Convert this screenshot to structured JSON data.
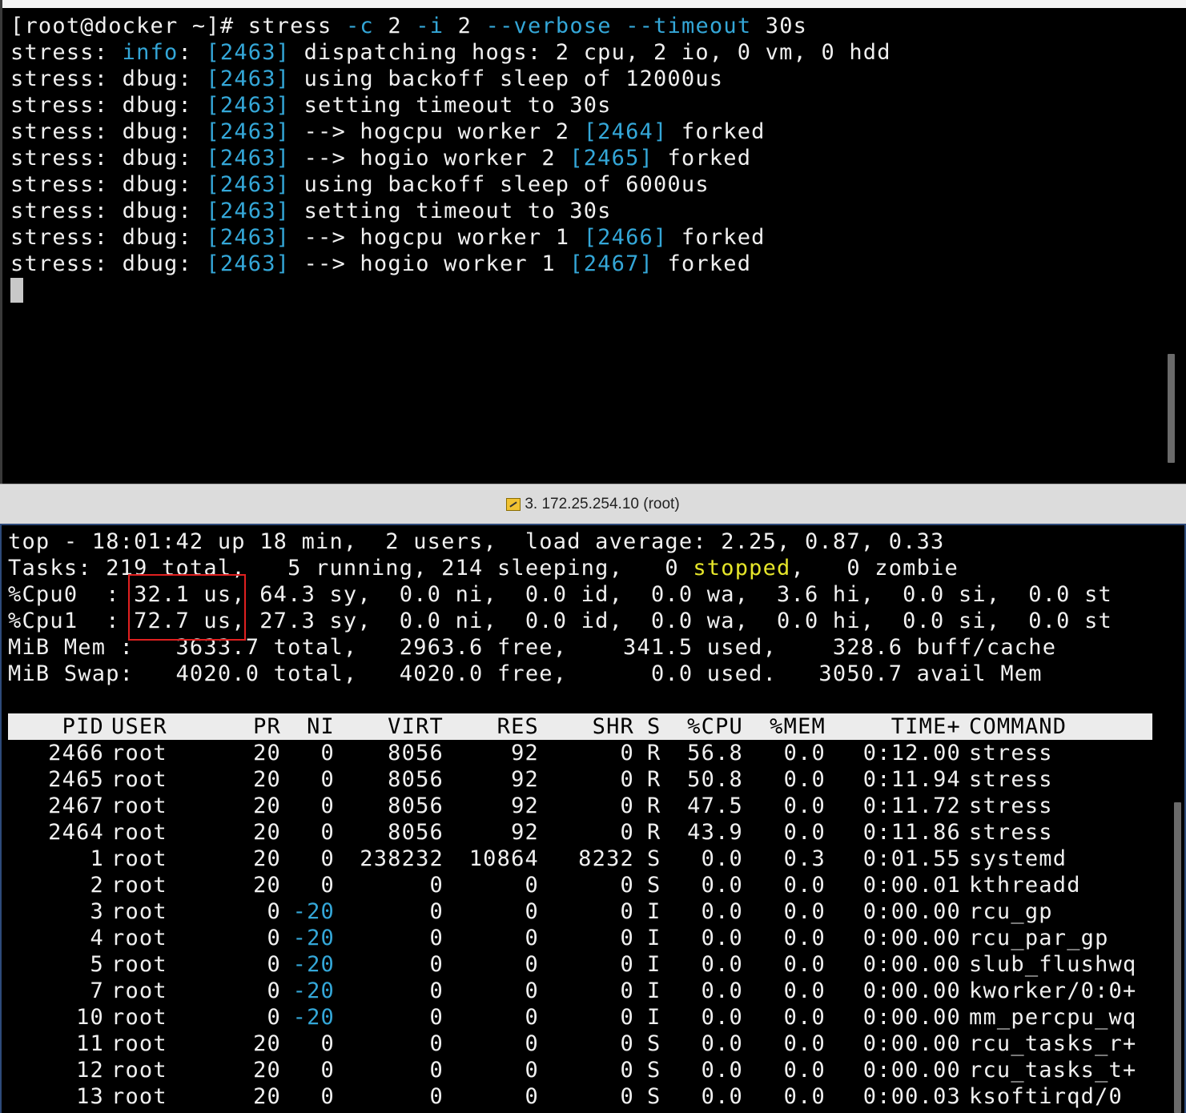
{
  "top_terminal": {
    "command_line": {
      "prompt": "[root@docker ~]# ",
      "cmd": "stress",
      "flag_c": "-c",
      "val_c": "2",
      "flag_i": "-i",
      "val_i": "2",
      "flag_verbose": "--verbose",
      "flag_timeout": "--timeout",
      "val_timeout": "30s"
    },
    "log_lines": [
      {
        "prefix": "stress: ",
        "level": "info",
        "pid": "[2463]",
        "msg": " dispatching hogs: 2 cpu, 2 io, 0 vm, 0 hdd",
        "worker_pid": "",
        "suffix": ""
      },
      {
        "prefix": "stress: ",
        "level": "dbug",
        "pid": "[2463]",
        "msg": " using backoff sleep of 12000us",
        "worker_pid": "",
        "suffix": ""
      },
      {
        "prefix": "stress: ",
        "level": "dbug",
        "pid": "[2463]",
        "msg": " setting timeout to 30s",
        "worker_pid": "",
        "suffix": ""
      },
      {
        "prefix": "stress: ",
        "level": "dbug",
        "pid": "[2463]",
        "msg": " --> hogcpu worker 2 ",
        "worker_pid": "[2464]",
        "suffix": " forked"
      },
      {
        "prefix": "stress: ",
        "level": "dbug",
        "pid": "[2463]",
        "msg": " --> hogio worker 2 ",
        "worker_pid": "[2465]",
        "suffix": " forked"
      },
      {
        "prefix": "stress: ",
        "level": "dbug",
        "pid": "[2463]",
        "msg": " using backoff sleep of 6000us",
        "worker_pid": "",
        "suffix": ""
      },
      {
        "prefix": "stress: ",
        "level": "dbug",
        "pid": "[2463]",
        "msg": " setting timeout to 30s",
        "worker_pid": "",
        "suffix": ""
      },
      {
        "prefix": "stress: ",
        "level": "dbug",
        "pid": "[2463]",
        "msg": " --> hogcpu worker 1 ",
        "worker_pid": "[2466]",
        "suffix": " forked"
      },
      {
        "prefix": "stress: ",
        "level": "dbug",
        "pid": "[2463]",
        "msg": " --> hogio worker 1 ",
        "worker_pid": "[2467]",
        "suffix": " forked"
      }
    ]
  },
  "tab_title": {
    "icon": "pencil-icon",
    "label": "3. 172.25.254.10 (root)"
  },
  "top_monitor": {
    "summary": {
      "line1": "top - 18:01:42 up 18 min,  2 users,  load average: 2.25, 0.87, 0.33",
      "tasks_a": "Tasks: 219 total,   5 running, 214 sleeping,   0 ",
      "tasks_stopped": "stopped",
      "tasks_b": ",   0 zombie",
      "cpu0": "%Cpu0  : 32.1 us, 64.3 sy,  0.0 ni,  0.0 id,  0.0 wa,  3.6 hi,  0.0 si,  0.0 st",
      "cpu1": "%Cpu1  : 72.7 us, 27.3 sy,  0.0 ni,  0.0 id,  0.0 wa,  0.0 hi,  0.0 si,  0.0 st",
      "mem": "MiB Mem :   3633.7 total,   2963.6 free,    341.5 used,    328.6 buff/cache",
      "swap": "MiB Swap:   4020.0 total,   4020.0 free,      0.0 used.   3050.7 avail Mem"
    },
    "columns": [
      "PID",
      "USER",
      "PR",
      "NI",
      "VIRT",
      "RES",
      "SHR",
      "S",
      "%CPU",
      "%MEM",
      "TIME+",
      "COMMAND"
    ],
    "processes": [
      [
        "2466",
        "root",
        "20",
        "0",
        "8056",
        "92",
        "0",
        "R",
        "56.8",
        "0.0",
        "0:12.00",
        "stress"
      ],
      [
        "2465",
        "root",
        "20",
        "0",
        "8056",
        "92",
        "0",
        "R",
        "50.8",
        "0.0",
        "0:11.94",
        "stress"
      ],
      [
        "2467",
        "root",
        "20",
        "0",
        "8056",
        "92",
        "0",
        "R",
        "47.5",
        "0.0",
        "0:11.72",
        "stress"
      ],
      [
        "2464",
        "root",
        "20",
        "0",
        "8056",
        "92",
        "0",
        "R",
        "43.9",
        "0.0",
        "0:11.86",
        "stress"
      ],
      [
        "1",
        "root",
        "20",
        "0",
        "238232",
        "10864",
        "8232",
        "S",
        "0.0",
        "0.3",
        "0:01.55",
        "systemd"
      ],
      [
        "2",
        "root",
        "20",
        "0",
        "0",
        "0",
        "0",
        "S",
        "0.0",
        "0.0",
        "0:00.01",
        "kthreadd"
      ],
      [
        "3",
        "root",
        "0",
        "-20",
        "0",
        "0",
        "0",
        "I",
        "0.0",
        "0.0",
        "0:00.00",
        "rcu_gp"
      ],
      [
        "4",
        "root",
        "0",
        "-20",
        "0",
        "0",
        "0",
        "I",
        "0.0",
        "0.0",
        "0:00.00",
        "rcu_par_gp"
      ],
      [
        "5",
        "root",
        "0",
        "-20",
        "0",
        "0",
        "0",
        "I",
        "0.0",
        "0.0",
        "0:00.00",
        "slub_flushwq"
      ],
      [
        "7",
        "root",
        "0",
        "-20",
        "0",
        "0",
        "0",
        "I",
        "0.0",
        "0.0",
        "0:00.00",
        "kworker/0:0+"
      ],
      [
        "10",
        "root",
        "0",
        "-20",
        "0",
        "0",
        "0",
        "I",
        "0.0",
        "0.0",
        "0:00.00",
        "mm_percpu_wq"
      ],
      [
        "11",
        "root",
        "20",
        "0",
        "0",
        "0",
        "0",
        "S",
        "0.0",
        "0.0",
        "0:00.00",
        "rcu_tasks_r+"
      ],
      [
        "12",
        "root",
        "20",
        "0",
        "0",
        "0",
        "0",
        "S",
        "0.0",
        "0.0",
        "0:00.00",
        "rcu_tasks_t+"
      ],
      [
        "13",
        "root",
        "20",
        "0",
        "0",
        "0",
        "0",
        "S",
        "0.0",
        "0.0",
        "0:00.03",
        "ksoftirqd/0"
      ]
    ]
  },
  "colors": {
    "terminal_bg": "#000000",
    "text": "#f0f0f0",
    "highlight_blue": "#34a7d8",
    "stopped_yellow": "#e6e62a",
    "annotation_red": "#e02020",
    "header_bar": "#ececec"
  }
}
